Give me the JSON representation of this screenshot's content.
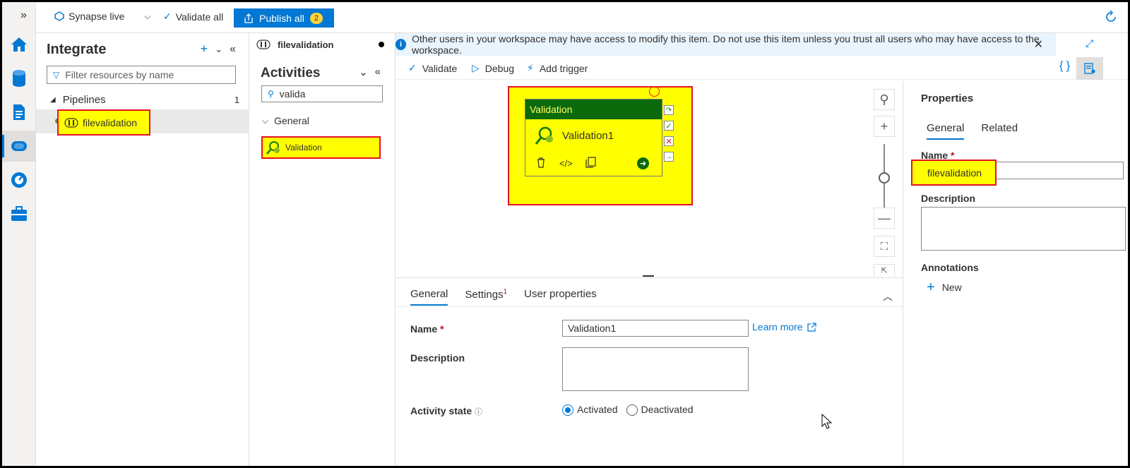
{
  "topbar": {
    "workspace_mode": "Synapse live",
    "validate_all": "Validate all",
    "publish_all": "Publish all",
    "publish_count": "2"
  },
  "rail": {
    "icons": [
      "expand-icon",
      "home-icon",
      "data-icon",
      "develop-icon",
      "integrate-icon",
      "monitor-icon",
      "manage-icon"
    ],
    "active": "integrate-icon"
  },
  "integrate": {
    "title": "Integrate",
    "filter_placeholder": "Filter resources by name",
    "pipelines_label": "Pipelines",
    "pipelines_count": "1",
    "pipeline_name": "filevalidation"
  },
  "activities": {
    "tab_label": "filevalidation",
    "title": "Activities",
    "search_value": "valida",
    "group_label": "General",
    "item_label": "Validation"
  },
  "banner": {
    "text": "Other users in your workspace may have access to modify this item. Do not use this item unless you trust all users who may have access to the workspace."
  },
  "canvas_toolbar": {
    "validate": "Validate",
    "debug": "Debug",
    "add_trigger": "Add trigger"
  },
  "canvas": {
    "card_type": "Validation",
    "card_name": "Validation1"
  },
  "bottom_panel": {
    "tabs": [
      "General",
      "Settings",
      "User properties"
    ],
    "settings_badge": "1",
    "name_label": "Name",
    "required_mark": "*",
    "name_value": "Validation1",
    "learn_more": "Learn more",
    "description_label": "Description",
    "activity_state_label": "Activity state",
    "activated": "Activated",
    "deactivated": "Deactivated",
    "selected_state": "Activated"
  },
  "properties": {
    "title": "Properties",
    "tabs": [
      "General",
      "Related"
    ],
    "name_label": "Name",
    "required_mark": "*",
    "name_value": "filevalidation",
    "description_label": "Description",
    "annotations_label": "Annotations",
    "new_label": "New"
  },
  "colors": {
    "accent": "#0078d4",
    "highlight": "#ffff00",
    "highlight_border": "#e81123",
    "activity_header": "#0b6a0b"
  }
}
